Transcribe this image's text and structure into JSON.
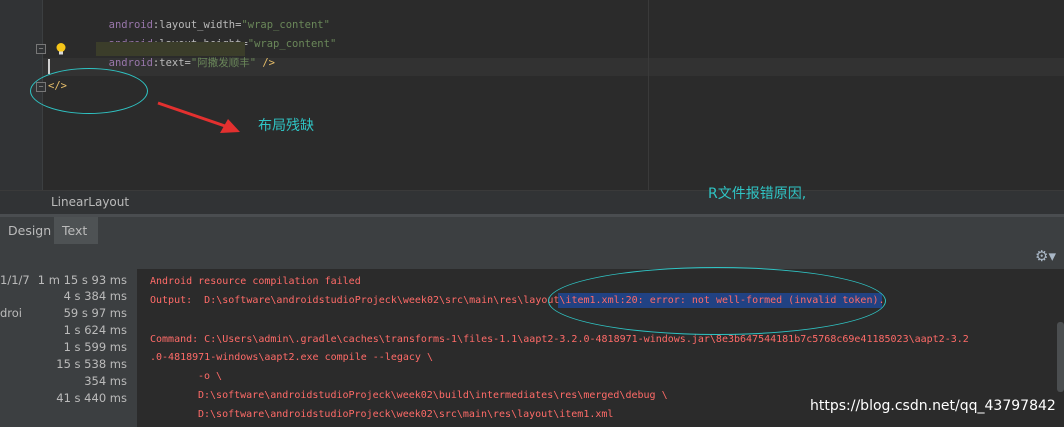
{
  "editor": {
    "lines": [
      {
        "ns": "android",
        "attr": "layout_width",
        "value": "\"wrap_content\""
      },
      {
        "ns": "android",
        "attr": "layout_height",
        "value": "\"wrap_content\""
      },
      {
        "ns": "android",
        "attr": "text",
        "value": "\"阿撒发顺丰\"",
        "close": " />"
      }
    ],
    "closing_tag": "</>"
  },
  "annotations": {
    "layout_missing": "布局残缺",
    "r_file_error": "R文件报错原因,"
  },
  "breadcrumb": "LinearLayout",
  "tabs": {
    "design": "Design",
    "text": "Text"
  },
  "build_tree": [
    {
      "left": "1/1/7",
      "right": "1 m 15 s 93 ms"
    },
    {
      "left": "",
      "right": "4 s 384 ms"
    },
    {
      "left": "droi",
      "right": "59 s 97 ms"
    },
    {
      "left": "",
      "right": "1 s 624 ms"
    },
    {
      "left": "",
      "right": "1 s 599 ms"
    },
    {
      "left": "",
      "right": "15 s 538 ms"
    },
    {
      "left": "",
      "right": "354 ms"
    },
    {
      "left": "",
      "right": "41 s 440 ms"
    }
  ],
  "log": {
    "line1": "Android resource compilation failed",
    "line2_prefix": "Output:  D:\\software\\androidstudioProjeck\\week02\\src\\main\\res\\layout",
    "line2_highlight": "\\item1.xml:20: error: not well-formed (invalid token).",
    "line3": "Command: C:\\Users\\admin\\.gradle\\caches\\transforms-1\\files-1.1\\aapt2-3.2.0-4818971-windows.jar\\8e3b647544181b7c5768c69e41185023\\aapt2-3.2",
    "line4": ".0-4818971-windows\\aapt2.exe compile --legacy \\",
    "line5": "-o \\",
    "line6": "D:\\software\\androidstudioProjeck\\week02\\build\\intermediates\\res\\merged\\debug \\",
    "line7": "D:\\software\\androidstudioProjeck\\week02\\src\\main\\res\\layout\\item1.xml"
  },
  "watermark": "https://blog.csdn.net/qq_43797842",
  "icons": {
    "gear": "gear-icon",
    "bulb": "lightbulb-icon",
    "fold": "fold-icon"
  }
}
